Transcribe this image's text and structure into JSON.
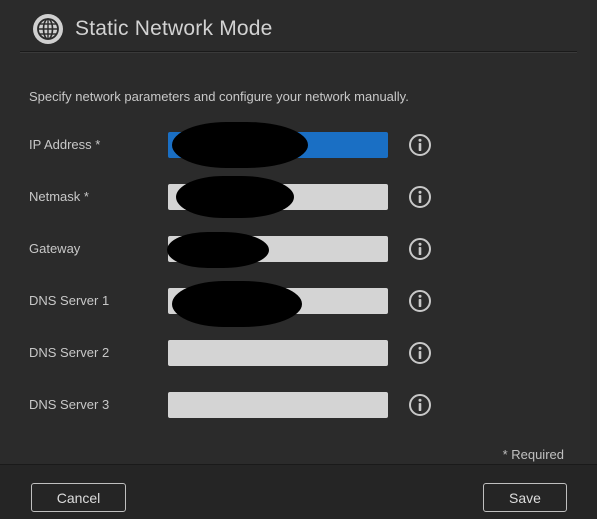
{
  "dialog": {
    "title": "Static Network Mode",
    "title_icon": "globe-icon",
    "description": "Specify network parameters and configure your network manually.",
    "fields": [
      {
        "label": "IP Address *",
        "value": "",
        "focused": true,
        "redacted": true
      },
      {
        "label": "Netmask *",
        "value": "",
        "focused": false,
        "redacted": true
      },
      {
        "label": "Gateway",
        "value": "",
        "focused": false,
        "redacted": true
      },
      {
        "label": "DNS Server 1",
        "value": "",
        "focused": false,
        "redacted": true
      },
      {
        "label": "DNS Server 2",
        "value": "",
        "focused": false,
        "redacted": false
      },
      {
        "label": "DNS Server 3",
        "value": "",
        "focused": false,
        "redacted": false
      }
    ],
    "info_icon": "info-circle-icon",
    "required_note": "* Required",
    "cancel_label": "Cancel",
    "save_label": "Save"
  },
  "colors": {
    "background": "#2b2b2b",
    "input_background": "#d4d4d4",
    "focused_input": "#1a6fc4",
    "text": "#c8c8c8"
  }
}
